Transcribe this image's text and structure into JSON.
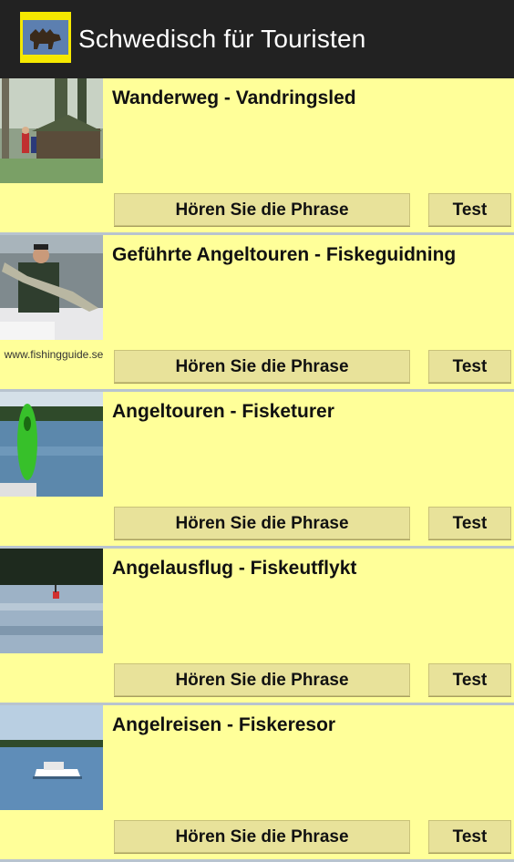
{
  "app": {
    "title": "Schwedisch für Touristen",
    "icon": "moose-logo-icon"
  },
  "items": [
    {
      "phrase": "Wanderweg - Vandringsled",
      "image": "forest-trail-cabin",
      "caption": "",
      "listen_label": "Hören Sie die Phrase",
      "test_label": "Test"
    },
    {
      "phrase": "Geführte Angeltouren - Fiskeguidning",
      "image": "man-holding-pike",
      "caption": "www.fishingguide.se",
      "listen_label": "Hören Sie die Phrase",
      "test_label": "Test"
    },
    {
      "phrase": "Angeltouren - Fisketurer",
      "image": "green-lure-lake",
      "caption": "",
      "listen_label": "Hören Sie die Phrase",
      "test_label": "Test"
    },
    {
      "phrase": "Angelausflug - Fiskeutflykt",
      "image": "float-on-water",
      "caption": "",
      "listen_label": "Hören Sie die Phrase",
      "test_label": "Test"
    },
    {
      "phrase": "Angelreisen - Fiskeresor",
      "image": "boat-on-lake",
      "caption": "",
      "listen_label": "Hören Sie die Phrase",
      "test_label": "Test"
    }
  ],
  "colors": {
    "background": "#ffff99",
    "appbar": "#222222",
    "button": "#e8e29a",
    "divider": "#b8c4cf"
  }
}
